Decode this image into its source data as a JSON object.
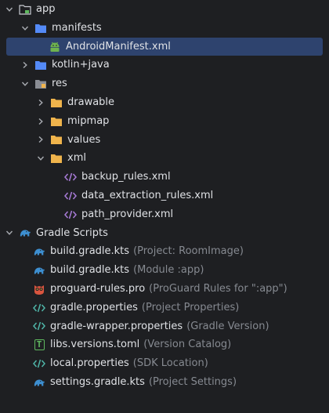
{
  "tree": {
    "rows": [
      {
        "label": "app",
        "hint": ""
      },
      {
        "label": "manifests",
        "hint": ""
      },
      {
        "label": "AndroidManifest.xml",
        "hint": ""
      },
      {
        "label": "kotlin+java",
        "hint": ""
      },
      {
        "label": "res",
        "hint": ""
      },
      {
        "label": "drawable",
        "hint": ""
      },
      {
        "label": "mipmap",
        "hint": ""
      },
      {
        "label": "values",
        "hint": ""
      },
      {
        "label": "xml",
        "hint": ""
      },
      {
        "label": "backup_rules.xml",
        "hint": ""
      },
      {
        "label": "data_extraction_rules.xml",
        "hint": ""
      },
      {
        "label": "path_provider.xml",
        "hint": ""
      },
      {
        "label": "Gradle Scripts",
        "hint": ""
      },
      {
        "label": "build.gradle.kts",
        "hint": "(Project: RoomImage)"
      },
      {
        "label": "build.gradle.kts",
        "hint": "(Module :app)"
      },
      {
        "label": "proguard-rules.pro",
        "hint": "(ProGuard Rules for \":app\")"
      },
      {
        "label": "gradle.properties",
        "hint": "(Project Properties)"
      },
      {
        "label": "gradle-wrapper.properties",
        "hint": "(Gradle Version)"
      },
      {
        "label": "libs.versions.toml",
        "hint": "(Version Catalog)"
      },
      {
        "label": "local.properties",
        "hint": "(SDK Location)"
      },
      {
        "label": "settings.gradle.kts",
        "hint": "(Project Settings)"
      }
    ],
    "selected_row": "AndroidManifest.xml"
  },
  "icons": {
    "toml_glyph": "T"
  },
  "colors": {
    "background": "#1e1f22",
    "selection": "#2e436e",
    "folder_blue": "#548af7",
    "folder_yellow": "#f0b44c",
    "android_green": "#6fb34f",
    "gradle_blue": "#3d8fd1",
    "xml_purple": "#a87bd8",
    "properties_teal": "#4fb5a8",
    "hint_text": "#868a91"
  }
}
